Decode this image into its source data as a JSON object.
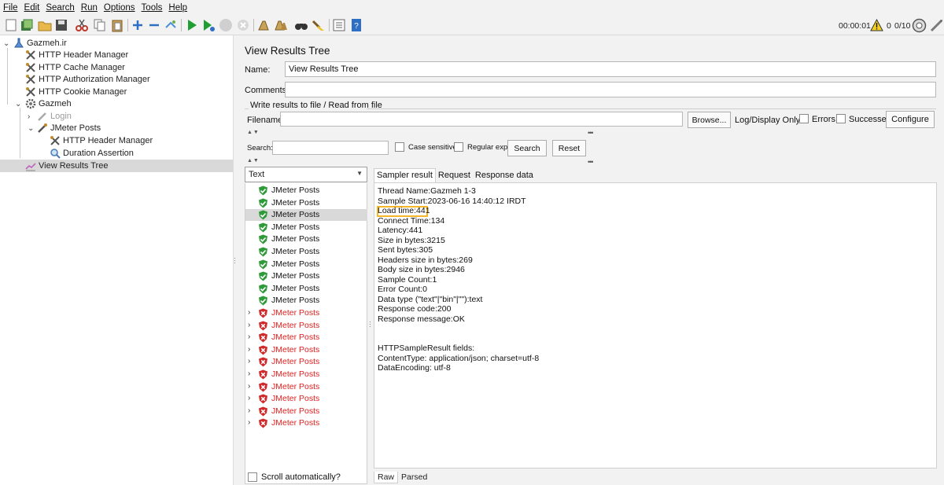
{
  "menu": [
    "File",
    "Edit",
    "Search",
    "Run",
    "Options",
    "Tools",
    "Help"
  ],
  "toolbar": {
    "timer": "00:00:01",
    "warnings": "0",
    "threads": "0/10"
  },
  "tree": [
    {
      "label": "Gazmeh.ir",
      "icon": "test-plan-icon"
    },
    {
      "label": "HTTP Header Manager",
      "icon": "tools-icon"
    },
    {
      "label": "HTTP Cache Manager",
      "icon": "tools-icon"
    },
    {
      "label": "HTTP Authorization Manager",
      "icon": "tools-icon"
    },
    {
      "label": "HTTP Cookie Manager",
      "icon": "tools-icon"
    },
    {
      "label": "Gazmeh",
      "icon": "gear-icon"
    },
    {
      "label": "Login",
      "icon": "sampler-icon",
      "disabled": true
    },
    {
      "label": "JMeter Posts",
      "icon": "sampler-icon"
    },
    {
      "label": "HTTP Header Manager",
      "icon": "tools-icon"
    },
    {
      "label": "Duration Assertion",
      "icon": "magnifier-icon"
    },
    {
      "label": "View Results Tree",
      "icon": "listener-icon",
      "selected": true
    }
  ],
  "panel": {
    "title": "View Results Tree",
    "name_label": "Name:",
    "name_value": "View Results Tree",
    "comments_label": "Comments:",
    "comments_value": "",
    "file_group_label": "Write results to file / Read from file",
    "filename_label": "Filename",
    "filename_value": "",
    "browse_label": "Browse...",
    "log_display_label": "Log/Display Only:",
    "errors_label": "Errors",
    "successes_label": "Successes",
    "configure_label": "Configure",
    "search_label": "Search:",
    "search_value": "",
    "case_sensitive_label": "Case sensitive",
    "regex_label": "Regular exp.",
    "search_button": "Search",
    "reset_button": "Reset",
    "renderer": "Text",
    "scroll_auto_label": "Scroll automatically?"
  },
  "results": [
    {
      "label": "JMeter Posts",
      "status": "ok"
    },
    {
      "label": "JMeter Posts",
      "status": "ok"
    },
    {
      "label": "JMeter Posts",
      "status": "ok",
      "selected": true
    },
    {
      "label": "JMeter Posts",
      "status": "ok"
    },
    {
      "label": "JMeter Posts",
      "status": "ok"
    },
    {
      "label": "JMeter Posts",
      "status": "ok"
    },
    {
      "label": "JMeter Posts",
      "status": "ok"
    },
    {
      "label": "JMeter Posts",
      "status": "ok"
    },
    {
      "label": "JMeter Posts",
      "status": "ok"
    },
    {
      "label": "JMeter Posts",
      "status": "ok"
    },
    {
      "label": "JMeter Posts",
      "status": "fail"
    },
    {
      "label": "JMeter Posts",
      "status": "fail"
    },
    {
      "label": "JMeter Posts",
      "status": "fail"
    },
    {
      "label": "JMeter Posts",
      "status": "fail"
    },
    {
      "label": "JMeter Posts",
      "status": "fail"
    },
    {
      "label": "JMeter Posts",
      "status": "fail"
    },
    {
      "label": "JMeter Posts",
      "status": "fail"
    },
    {
      "label": "JMeter Posts",
      "status": "fail"
    },
    {
      "label": "JMeter Posts",
      "status": "fail"
    },
    {
      "label": "JMeter Posts",
      "status": "fail"
    }
  ],
  "detail_tabs": [
    "Sampler result",
    "Request",
    "Response data"
  ],
  "detail_lines": [
    "Thread Name:Gazmeh 1-3",
    "Sample Start:2023-06-16 14:40:12 IRDT",
    "Load time:441",
    "Connect Time:134",
    "Latency:441",
    "Size in bytes:3215",
    "Sent bytes:305",
    "Headers size in bytes:269",
    "Body size in bytes:2946",
    "Sample Count:1",
    "Error Count:0",
    "Data type (\"text\"|\"bin\"|\"\"):text",
    "Response code:200",
    "Response message:OK",
    "",
    "",
    "HTTPSampleResult fields:",
    "ContentType: application/json; charset=utf-8",
    "DataEncoding: utf-8"
  ],
  "bottom_tabs": [
    "Raw",
    "Parsed"
  ]
}
